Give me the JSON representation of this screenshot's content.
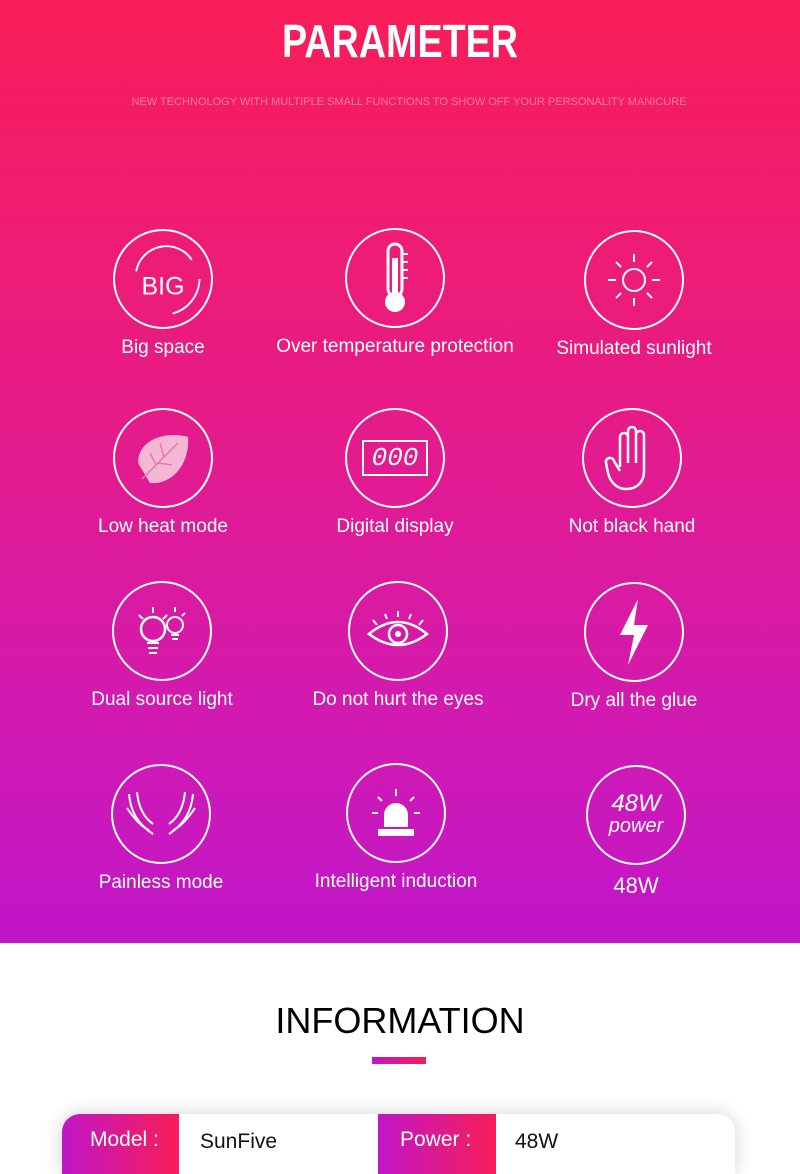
{
  "header": {
    "title": "PARAMETER",
    "subtitle": "NEW TECHNOLOGY WITH MULTIPLE SMALL FUNCTIONS TO SHOW OFF YOUR PERSONALITY MANICURE"
  },
  "features": [
    {
      "label": "Big space",
      "icon": "big-icon",
      "icon_text": "BIG"
    },
    {
      "label": "Over temperature protection",
      "icon": "thermometer-icon"
    },
    {
      "label": "Simulated sunlight",
      "icon": "sun-icon"
    },
    {
      "label": "Low heat mode",
      "icon": "leaf-icon"
    },
    {
      "label": "Digital display",
      "icon": "digital-display-icon",
      "icon_text": "000"
    },
    {
      "label": "Not black hand",
      "icon": "hand-icon"
    },
    {
      "label": "Dual source light",
      "icon": "bulbs-icon"
    },
    {
      "label": "Do not hurt the eyes",
      "icon": "eye-icon"
    },
    {
      "label": "Dry all the glue",
      "icon": "lightning-icon"
    },
    {
      "label": "Painless mode",
      "icon": "hands-icon"
    },
    {
      "label": "Intelligent induction",
      "icon": "alarm-light-icon"
    },
    {
      "label": "48W",
      "icon": "power-icon",
      "icon_text": "48W",
      "icon_text2": "power"
    }
  ],
  "information": {
    "title": "INFORMATION",
    "rows": [
      {
        "key": "Model :",
        "value": "SunFive"
      },
      {
        "key": "Power :",
        "value": "48W"
      }
    ]
  },
  "colors": {
    "gradient_top": "#f81d56",
    "gradient_bottom": "#c016c9"
  }
}
